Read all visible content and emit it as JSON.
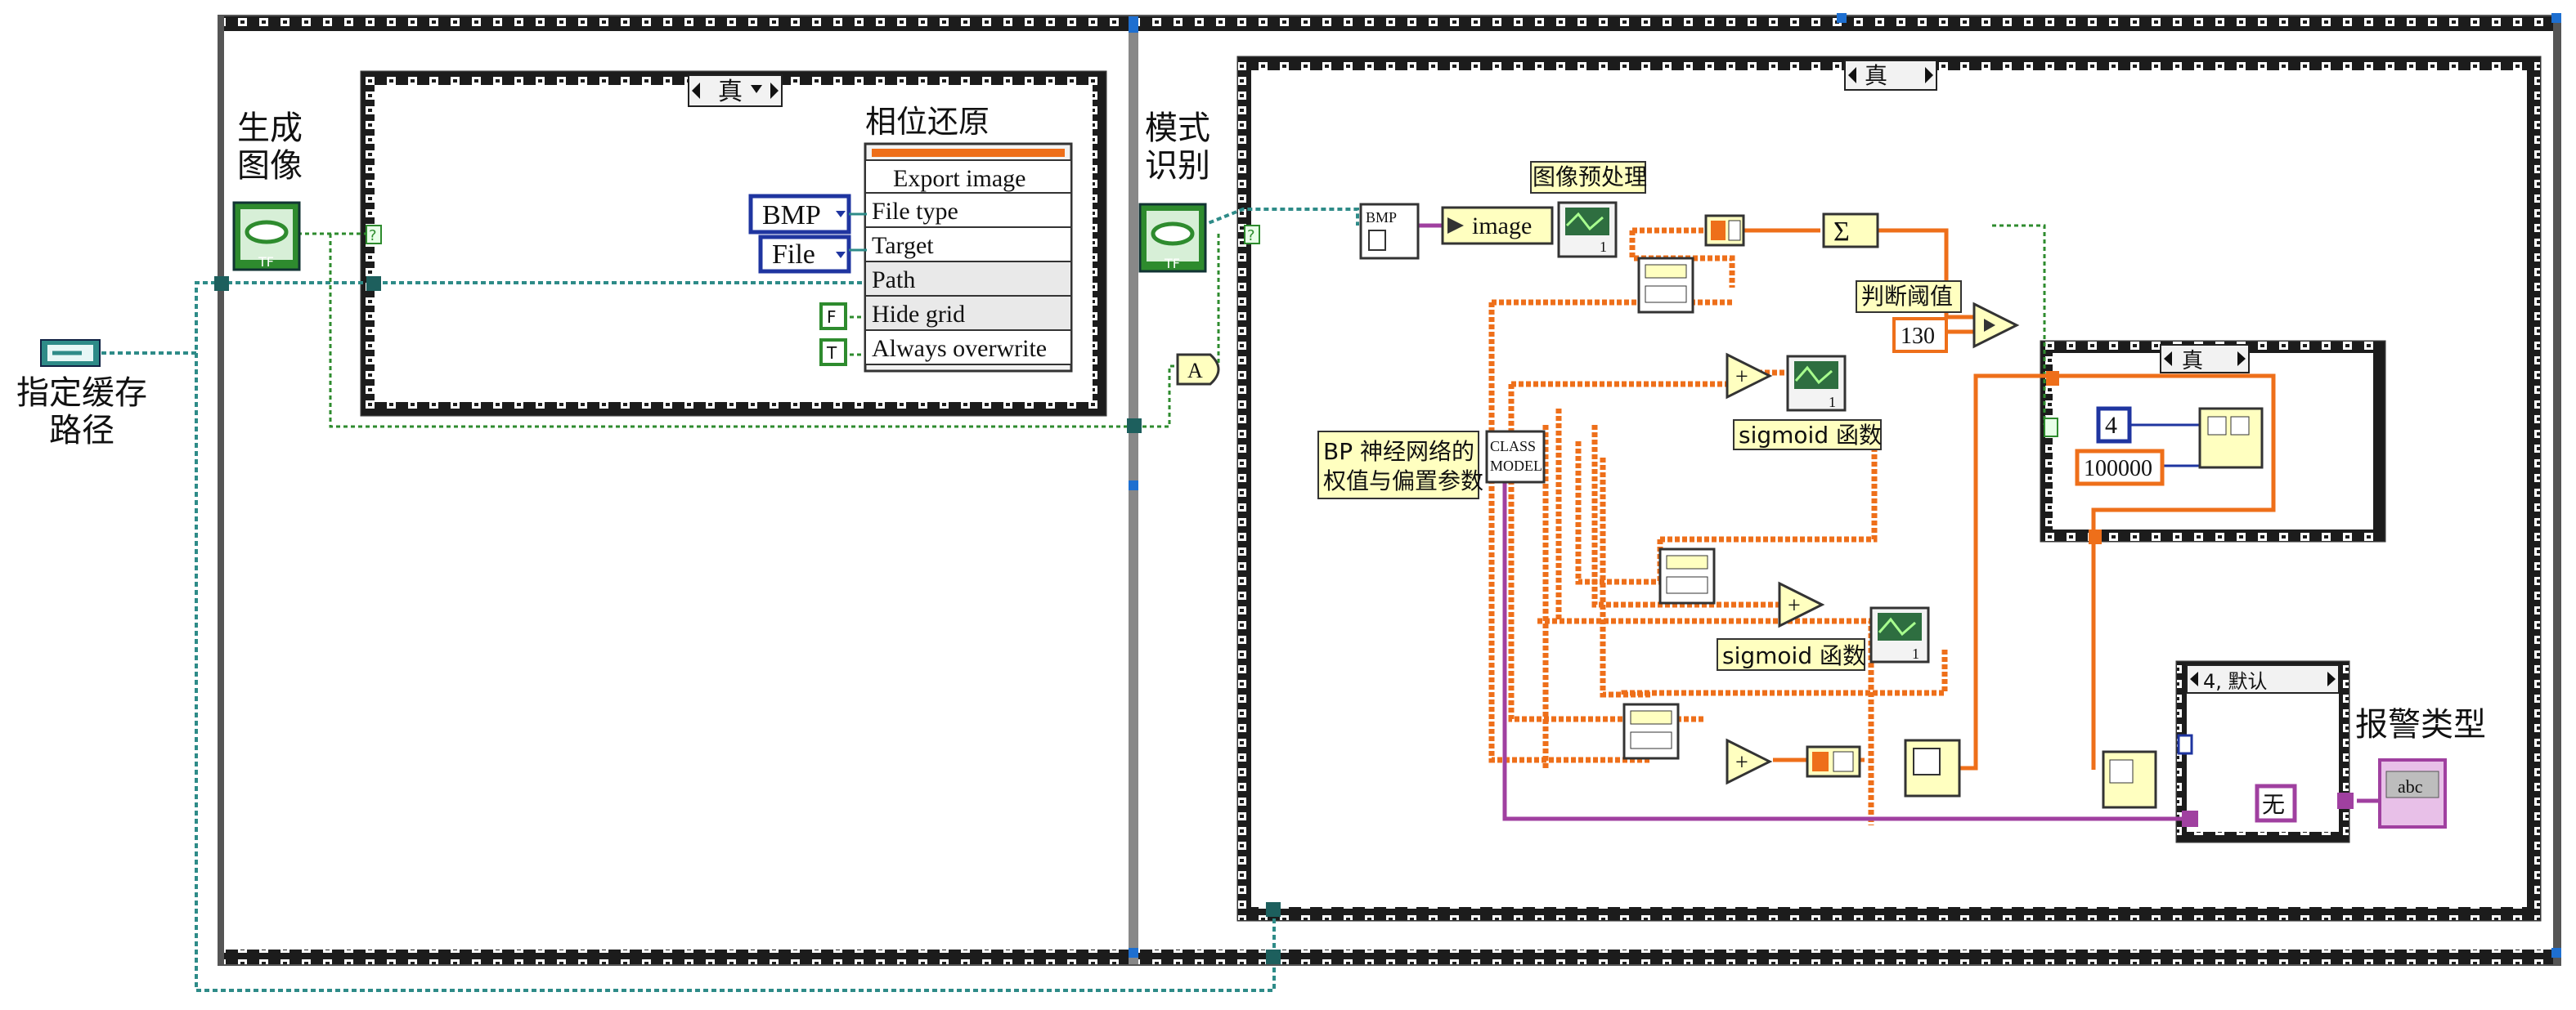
{
  "labels": {
    "buffer_path": [
      "指定缓存",
      "路径"
    ],
    "generate_image": [
      "生成",
      "图像"
    ],
    "pattern_recognition": [
      "模式",
      "识别"
    ],
    "phase_restore": "相位还原",
    "alarm_type": "报警类型",
    "image_preprocess": "图像预处理",
    "threshold_judge": "判断阈值",
    "bp_params": [
      "BP 神经网络的",
      "权值与偏置参数"
    ],
    "sigmoid_1": "sigmoid 函数",
    "sigmoid_2": "sigmoid 函数"
  },
  "case_selectors": {
    "left_case": "真",
    "right_case": "真",
    "inner_case": "真",
    "default_case": "4, 默认"
  },
  "export_node": {
    "title": "Export image",
    "rows": [
      "File type",
      "Target",
      "Path",
      "Hide grid",
      "Always overwrite"
    ]
  },
  "constants": {
    "bmp": "BMP",
    "file": "File",
    "false_bool": "F",
    "true_bool": "T",
    "threshold": "130",
    "four": "4",
    "hundred_k": "100000",
    "none": "无",
    "abc": "abc",
    "image_ref": "image",
    "bmp_small": "BMP",
    "tf": "TF",
    "class_model": [
      "CLASS",
      "MODEL"
    ],
    "a_node": "A",
    "one": "1",
    "help": "?"
  },
  "colors": {
    "boolean_wire": "#2e8b2e",
    "path_wire": "#2e8b88",
    "numeric_wire": "#ee6f1a",
    "string_wire": "#a040a0",
    "node_fill": "#ffffc0",
    "enum_border": "#1f35a0"
  }
}
